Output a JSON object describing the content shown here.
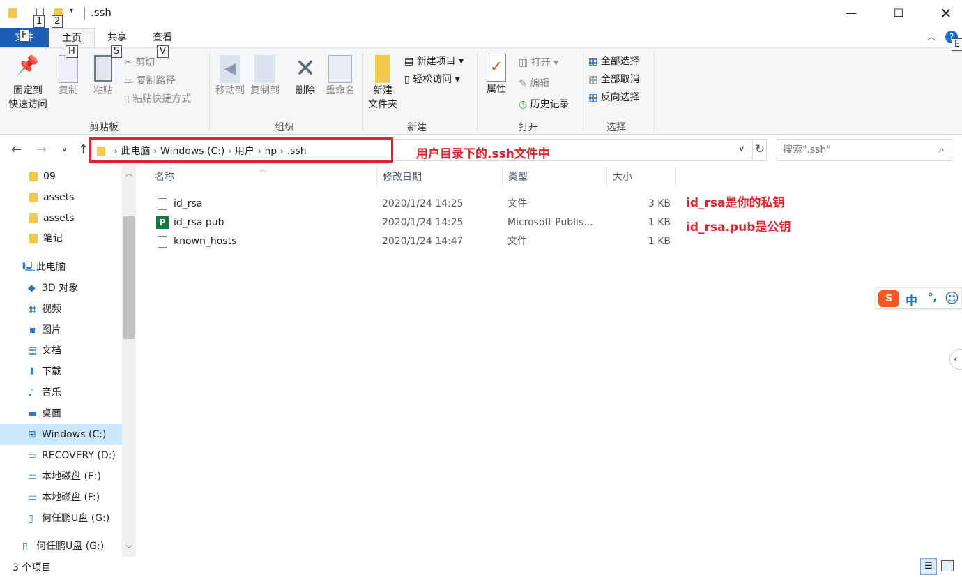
{
  "window": {
    "title": ".ssh",
    "quick_access_tips": [
      "1",
      "2"
    ]
  },
  "tabs": [
    {
      "label": "文件",
      "tip": "F"
    },
    {
      "label": "主页",
      "tip": "H"
    },
    {
      "label": "共享",
      "tip": "S"
    },
    {
      "label": "查看",
      "tip": "V"
    }
  ],
  "help_tip": "E",
  "ribbon": {
    "clipboard": {
      "label": "剪贴板",
      "pin": "固定到快速访问",
      "pin1": "固定到",
      "pin2": "快速访问",
      "copy": "复制",
      "paste": "粘贴",
      "cut": "剪切",
      "copy_path": "复制路径",
      "paste_shortcut": "粘贴快捷方式"
    },
    "organize": {
      "label": "组织",
      "move_to": "移动到",
      "copy_to": "复制到",
      "delete": "删除",
      "rename": "重命名"
    },
    "new": {
      "label": "新建",
      "new_folder1": "新建",
      "new_folder2": "文件夹",
      "new_item": "新建项目",
      "easy_access": "轻松访问"
    },
    "open": {
      "label": "打开",
      "properties": "属性",
      "open": "打开",
      "edit": "编辑",
      "history": "历史记录"
    },
    "select": {
      "label": "选择",
      "select_all": "全部选择",
      "select_none": "全部取消",
      "invert": "反向选择"
    }
  },
  "address": {
    "crumbs": [
      "此电脑",
      "Windows (C:)",
      "用户",
      "hp",
      ".ssh"
    ],
    "search_placeholder": "搜索\".ssh\""
  },
  "annotations": {
    "address": "用户目录下的.ssh文件中",
    "private": "id_rsa是你的私钥",
    "public": "id_rsa.pub是公钥"
  },
  "sidebar": {
    "items": [
      "09",
      "assets",
      "assets",
      "笔记",
      "此电脑",
      "3D 对象",
      "视频",
      "图片",
      "文档",
      "下载",
      "音乐",
      "桌面",
      "Windows (C:)",
      "RECOVERY (D:)",
      "本地磁盘 (E:)",
      "本地磁盘 (F:)",
      "何任鹏U盘 (G:)",
      "何任鹏U盘 (G:)"
    ],
    "selected": "Windows (C:)"
  },
  "columns": [
    "名称",
    "修改日期",
    "类型",
    "大小"
  ],
  "files": [
    {
      "name": "id_rsa",
      "date": "2020/1/24 14:25",
      "type": "文件",
      "size": "3 KB"
    },
    {
      "name": "id_rsa.pub",
      "date": "2020/1/24 14:25",
      "type": "Microsoft Publis...",
      "size": "1 KB"
    },
    {
      "name": "known_hosts",
      "date": "2020/1/24 14:47",
      "type": "文件",
      "size": "1 KB"
    }
  ],
  "status": {
    "count": "3 个项目"
  },
  "ime": {
    "lang": "中",
    "punct": "°,"
  }
}
